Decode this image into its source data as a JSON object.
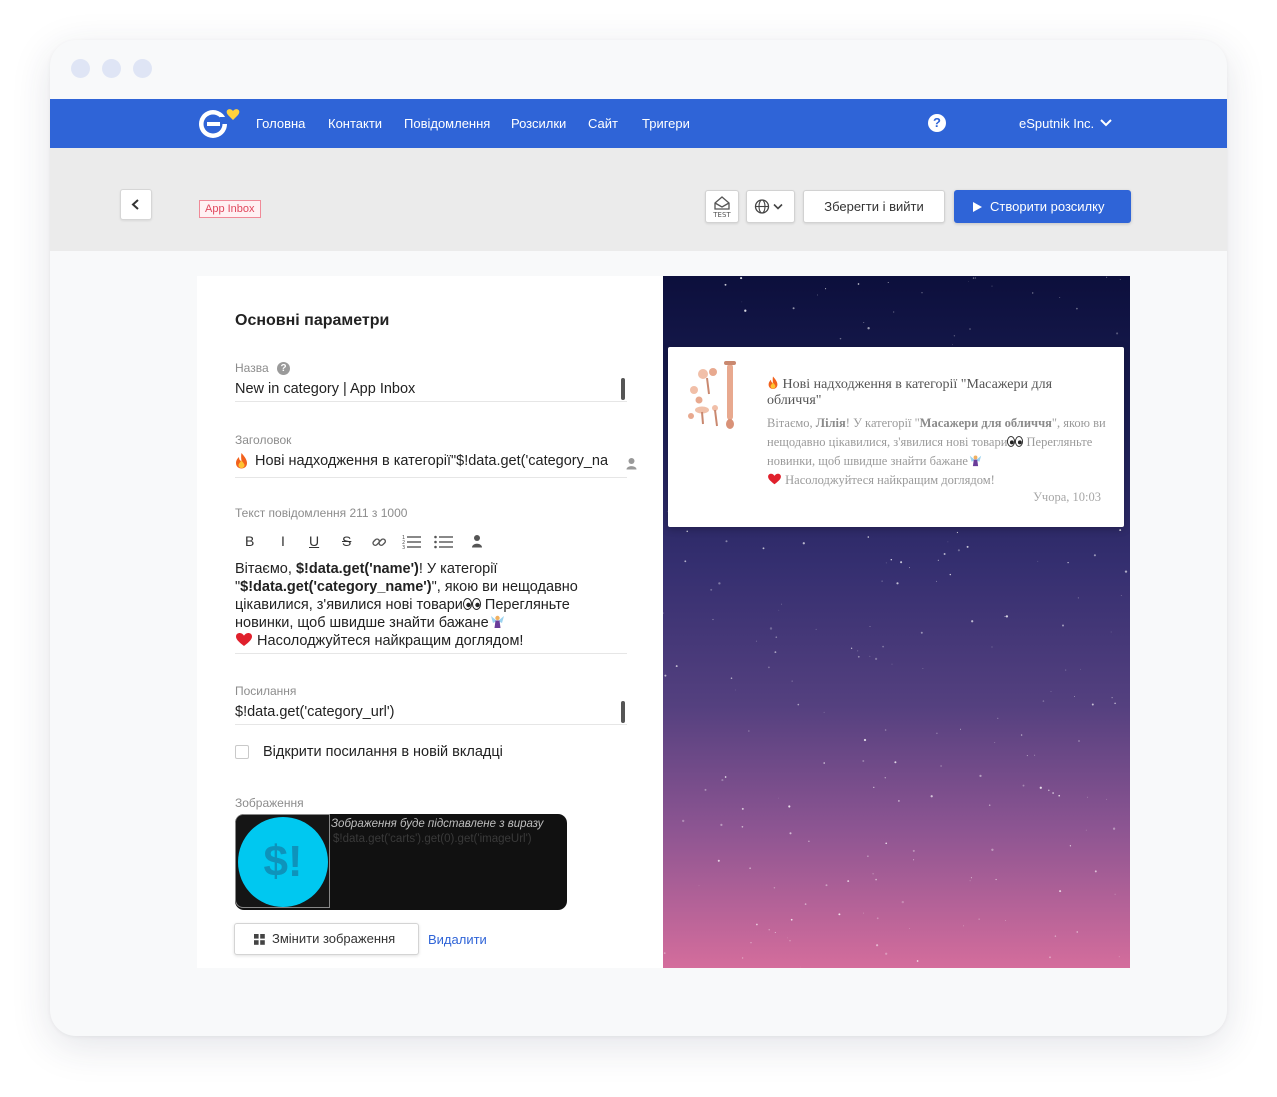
{
  "nav": {
    "items": [
      "Головна",
      "Контакти",
      "Повідомлення",
      "Розсилки",
      "Сайт",
      "Тригери"
    ],
    "help": "?",
    "account": "eSputnik Inc."
  },
  "toolbar": {
    "tag": "App Inbox",
    "test_label": "TEST",
    "save_label": "Зберегти і вийти",
    "create_label": "Створити розсилку"
  },
  "form": {
    "section_title": "Основні параметри",
    "name_label": "Назва",
    "name_value": "New in category | App Inbox",
    "subject_label": "Заголовок",
    "subject_value": "Нові надходження в категорії\"$!data.get('category_na",
    "text_label": "Текст повідомлення 211 з 1000",
    "body": {
      "p1": "Вітаємо, ",
      "p2": "$!data.get('name')",
      "p3": "! У категорії \"",
      "p4": "$!data.get('category_name')",
      "p5": "\", якою ви нещодавно цікавилися, з'явилися нові товари",
      "p6": " Перегляньте новинки, щоб швидше знайти бажане",
      "p7": "Насолоджуйтеся найкращим доглядом!"
    },
    "link_label": "Посилання",
    "link_value": "$!data.get('category_url')",
    "new_tab_label": "Відкрити посилання в новій вкладці",
    "image_label": "Зображення",
    "image_note": "Зображення буде підставлене з виразу",
    "image_expr": "$!data.get('carts').get(0).get('imageUrl')",
    "image_placeholder": "$!",
    "change_image_label": "Змінити зображення",
    "delete_label": "Видалити"
  },
  "preview": {
    "title": "Нові надходження в категорії \"Масажери для обличчя\"",
    "t1": "Вітаємо, ",
    "t2": "Лілія",
    "t3": "! У категорії \"",
    "t4": "Масажери для обличчя",
    "t5": "\", якою ви нещодавно цікавилися, з'явилися нові товари",
    "t6": " Перегляньте новинки, щоб швидше знайти бажане",
    "t7": "Насолоджуйтеся найкращим доглядом!",
    "time": "Учора, 10:03"
  },
  "colors": {
    "brand_blue": "#2f64d7",
    "tag_red": "#e0475d"
  }
}
